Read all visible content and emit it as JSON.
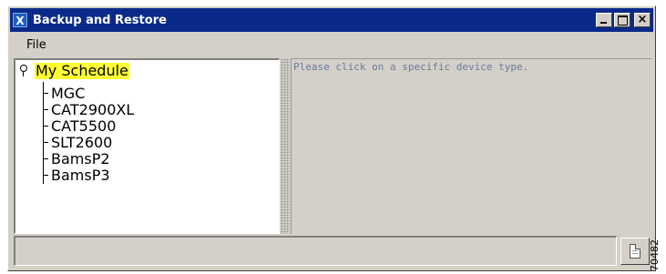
{
  "window": {
    "title": "Backup and Restore",
    "app_icon_glyph": "X",
    "controls": {
      "minimize": "minimize-icon",
      "maximize": "maximize-icon",
      "close_glyph": "×"
    }
  },
  "menubar": {
    "items": [
      {
        "label": "File"
      }
    ]
  },
  "tree": {
    "root": {
      "label": "My Schedule",
      "icon": "tree-root-toggle-icon",
      "highlight": "#ffff33"
    },
    "children": [
      {
        "label": "MGC"
      },
      {
        "label": "CAT2900XL"
      },
      {
        "label": "CAT5500"
      },
      {
        "label": "SLT2600"
      },
      {
        "label": "BamsP2"
      },
      {
        "label": "BamsP3"
      }
    ]
  },
  "detail": {
    "message": "Please click on a specific device type."
  },
  "statusbar": {
    "text": "",
    "log_button_icon": "document-icon"
  },
  "figure_id": "70482",
  "colors": {
    "titlebar": "#0a2a8a",
    "window_bg": "#d4d0c8",
    "message_text": "#6a7aa0"
  }
}
